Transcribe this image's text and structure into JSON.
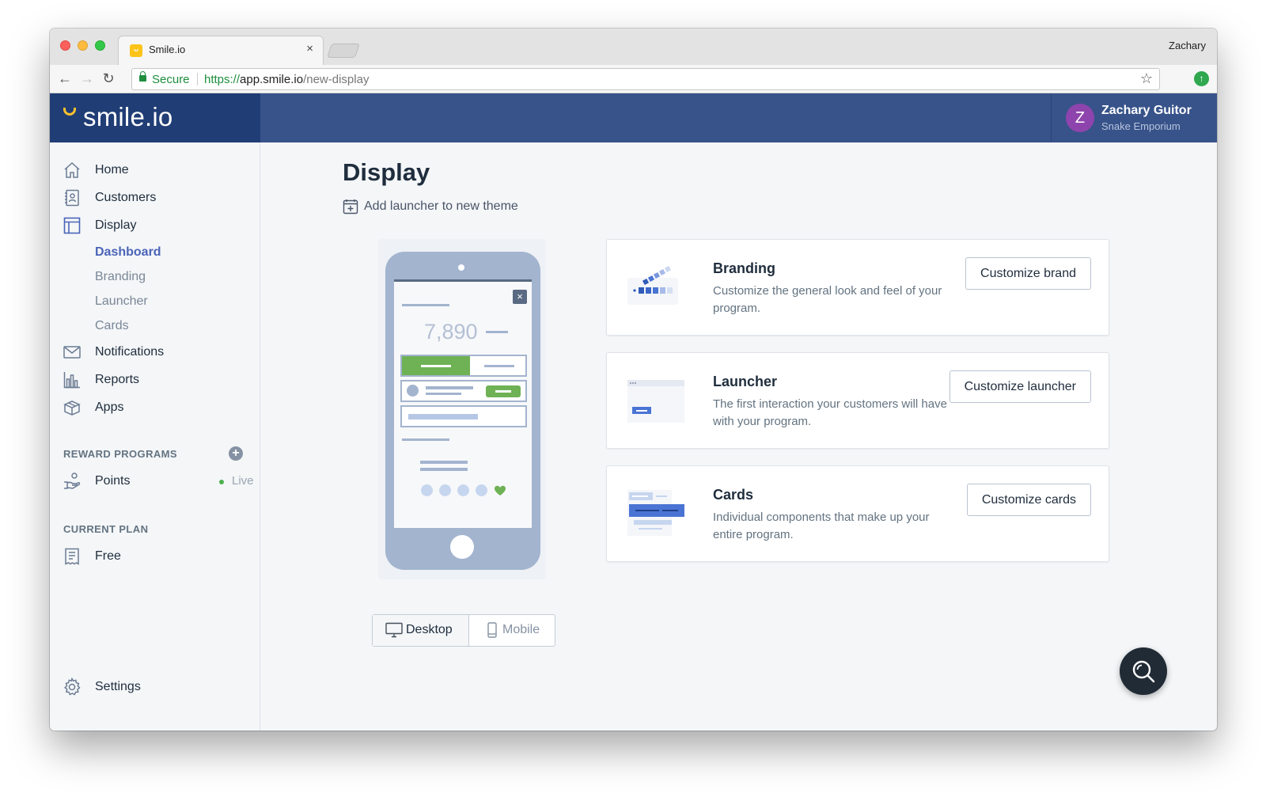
{
  "browser": {
    "tab_title": "Smile.io",
    "favicon_glyph": "ᴗ",
    "close_glyph": "×",
    "profile_name": "Zachary",
    "secure_label": "Secure",
    "url_scheme": "https://",
    "url_host": "app.smile.io",
    "url_path": "/new-display",
    "back_glyph": "←",
    "forward_glyph": "→",
    "reload_glyph": "↻",
    "star_glyph": "☆",
    "extension_glyph": "↑"
  },
  "header": {
    "logo_text": "smile.io",
    "user_initial": "Z",
    "user_name": "Zachary Guitor",
    "store_name": "Snake Emporium",
    "avatar_color": "#8e44ad",
    "brand_bar_color": "#38538a",
    "logo_bg_color": "#203d75"
  },
  "sidebar": {
    "items": [
      {
        "label": "Home",
        "icon": "home-icon"
      },
      {
        "label": "Customers",
        "icon": "customers-icon"
      },
      {
        "label": "Display",
        "icon": "display-icon"
      },
      {
        "label": "Notifications",
        "icon": "envelope-icon"
      },
      {
        "label": "Reports",
        "icon": "bar-chart-icon"
      },
      {
        "label": "Apps",
        "icon": "box-icon"
      }
    ],
    "display_subitems": [
      {
        "label": "Dashboard",
        "active": true
      },
      {
        "label": "Branding",
        "active": false
      },
      {
        "label": "Launcher",
        "active": false
      },
      {
        "label": "Cards",
        "active": false
      }
    ],
    "reward_programs_heading": "REWARD PROGRAMS",
    "add_glyph": "+",
    "points_label": "Points",
    "points_status": "Live",
    "current_plan_heading": "CURRENT PLAN",
    "plan_label": "Free",
    "settings_label": "Settings",
    "active_color": "#4a64b8"
  },
  "main": {
    "title": "Display",
    "add_launcher_label": "Add launcher to new theme",
    "preview": {
      "points_value": "7,890",
      "close_glyph": "×"
    },
    "toggle": {
      "desktop_label": "Desktop",
      "mobile_label": "Mobile",
      "selected": "Desktop"
    },
    "cards": [
      {
        "title": "Branding",
        "description": "Customize the general look and feel of your program.",
        "button": "Customize brand"
      },
      {
        "title": "Launcher",
        "description": "The first interaction your customers will have with your program.",
        "button": "Customize launcher"
      },
      {
        "title": "Cards",
        "description": "Individual components that make up your entire program.",
        "button": "Customize cards"
      }
    ]
  }
}
